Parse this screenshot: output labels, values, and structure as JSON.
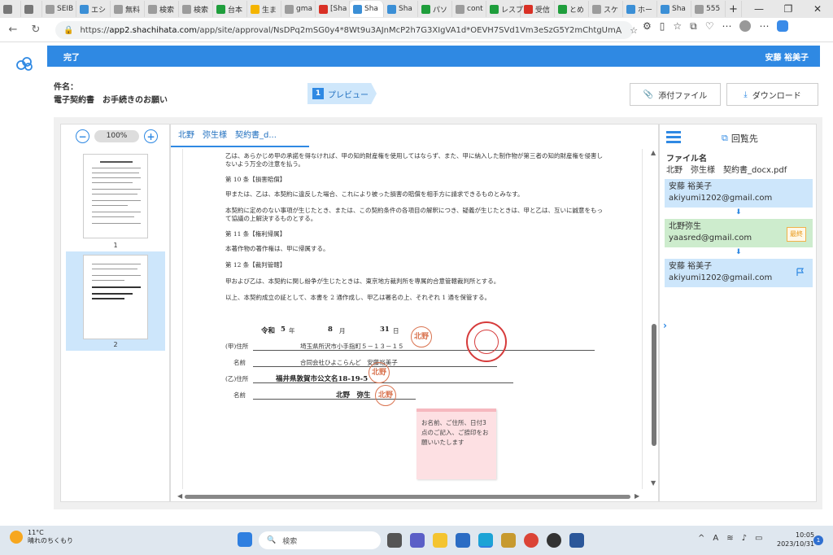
{
  "browser": {
    "tabs": [
      {
        "label": "",
        "color": "#777777"
      },
      {
        "label": "",
        "color": "#777777"
      },
      {
        "label": "SEIB",
        "color": "#9c9c9c"
      },
      {
        "label": "エシ",
        "color": "#3b8fd6"
      },
      {
        "label": "無料",
        "color": "#9c9c9c"
      },
      {
        "label": "検索",
        "color": "#9c9c9c"
      },
      {
        "label": "検索",
        "color": "#9c9c9c"
      },
      {
        "label": "台本",
        "color": "#1f9e3c"
      },
      {
        "label": "生ま",
        "color": "#f4b400"
      },
      {
        "label": "gma",
        "color": "#9c9c9c"
      },
      {
        "label": "[Sha",
        "color": "#d93025"
      },
      {
        "label": "Sha",
        "color": "#3b8fd6"
      },
      {
        "label": "Sha",
        "color": "#3b8fd6"
      },
      {
        "label": "パソ",
        "color": "#1f9e3c"
      },
      {
        "label": "cont",
        "color": "#9c9c9c"
      },
      {
        "label": "レスプ",
        "color": "#1f9e3c"
      },
      {
        "label": "受信",
        "color": "#d93025"
      },
      {
        "label": "とめ",
        "color": "#1f9e3c"
      },
      {
        "label": "スケ",
        "color": "#9c9c9c"
      },
      {
        "label": "ホー",
        "color": "#3b8fd6"
      },
      {
        "label": "Sha",
        "color": "#3b8fd6"
      },
      {
        "label": "555",
        "color": "#9c9c9c"
      }
    ],
    "url_prefix": "https://",
    "url_host": "app2.shachihata.com",
    "url_path": "/app/site/approval/NsDPq2mSG0y4*8Wt9u3AJnMcP2h7G3XIgVA1d*OEVH7SVd1Vm3eSzG5Y2mChtgUm"
  },
  "app": {
    "header_left": "完了",
    "header_user": "安藤 裕美子",
    "subject_label": "件名：",
    "subject_value": "電子契約書　お手続きのお願い",
    "step_number": "1",
    "step_label": "プレビュー",
    "attach_button": "添付ファイル",
    "download_button": "ダウンロード"
  },
  "thumbnails": {
    "zoom": "100%",
    "pages": [
      "1",
      "2"
    ]
  },
  "document": {
    "tab_label": "北野　弥生様　契約書_d...",
    "paragraphs": [
      "乙は、あらかじめ甲の承諾を得なければ、甲の知的財産権を使用してはならず、また、甲に納入した制作物が第三者の知的財産権を侵害しないよう万全の注意を払う。",
      "第 10 条【損害賠償】",
      "甲または、乙は、本契約に違反した場合、これにより被った損害の賠償を相手方に請求できるものとみなす。",
      "本契約に定めのない事項が生じたとき、または、この契約条件の各項目の解釈につき、疑義が生じたときは、甲と乙は、互いに誠意をもって協議の上解決するものとする。",
      "第 11 条【権利帰属】",
      "本著作物の著作権は、甲に帰属する。",
      "第 12 条【裁判管轄】",
      "甲および乙は、本契約に関し紛争が生じたときは、東京地方裁判所を専属的合意管轄裁判所とする。",
      "以上、本契約成立の証として、本書を 2 通作成し、甲乙は署名の上、それぞれ 1 通を保管する。"
    ],
    "date_era": "令和",
    "date_year": "5",
    "date_year_unit": "年",
    "date_month": "8",
    "date_month_unit": "月",
    "date_day": "31",
    "date_day_unit": "日",
    "party_a_address_label": "(甲)住所",
    "party_a_address": "埼玉県所沢市小手指町５－１３－１５",
    "party_a_name_label": "名前",
    "party_a_name": "合同会社ひよこらんど　安藤裕美子",
    "party_b_address_label": "(乙)住所",
    "party_b_address": "福井県敦賀市公文名18-19-5",
    "party_b_name_label": "名前",
    "party_b_name": "北野　弥生",
    "seal_text": "北野",
    "sticky_note": "お名前、ご住所、日付3点のご記入、ご捺印をお願いいたします"
  },
  "recipients": {
    "title": "回覧先",
    "file_label": "ファイル名",
    "file_name": "北野　弥生様　契約書_docx.pdf",
    "list": [
      {
        "name": "安藤 裕美子",
        "email": "akiyumi1202@gmail.com"
      },
      {
        "name": "北野弥生",
        "email": "yaasred@gmail.com",
        "badge": "最終"
      },
      {
        "name": "安藤 裕美子",
        "email": "akiyumi1202@gmail.com"
      }
    ]
  },
  "taskbar": {
    "temperature": "11°C",
    "weather": "晴れのちくもり",
    "search": "検索",
    "time": "10:05",
    "date": "2023/10/31",
    "notifications": "1"
  },
  "colors": {
    "brand": "#2f89e3",
    "seal": "#d9734f",
    "company_seal": "#d63b3b"
  }
}
